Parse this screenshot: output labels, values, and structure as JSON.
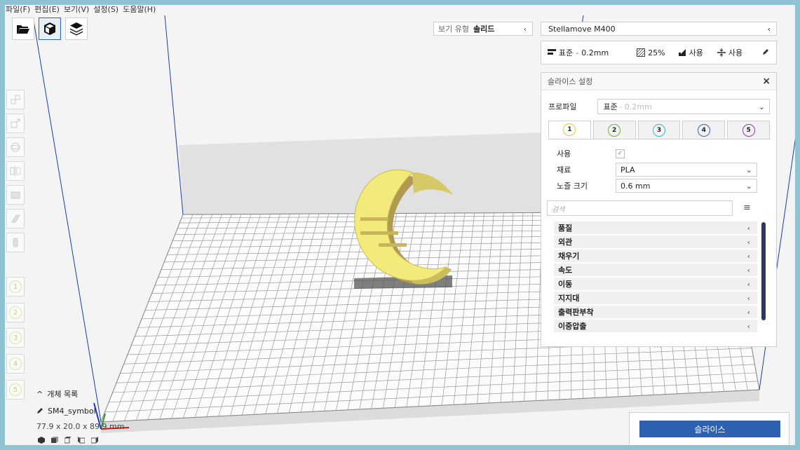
{
  "menu": [
    "파일(F)",
    "편집(E)",
    "보기(V)",
    "설정(S)",
    "도움말(H)"
  ],
  "view_type": {
    "label": "보기 유형",
    "value": "솔리드"
  },
  "printer": {
    "name": "Stellamove M400"
  },
  "quick": {
    "profile_name": "표준",
    "profile_layer": "0.2mm",
    "infill": "25%",
    "support": "사용",
    "adhesion": "사용"
  },
  "panel": {
    "title": "슬라이스 설정",
    "profile_label": "프로파일",
    "profile_name": "표준",
    "profile_layer": "0.2mm",
    "extruder_tabs": [
      "1",
      "2",
      "3",
      "4",
      "5"
    ],
    "fields": {
      "enable_label": "사용",
      "material_label": "재료",
      "material_value": "PLA",
      "nozzle_label": "노즐 크기",
      "nozzle_value": "0.6 mm"
    },
    "search_placeholder": "검색",
    "categories": [
      "품질",
      "외관",
      "채우기",
      "속도",
      "이동",
      "지지대",
      "출력판부착",
      "이중압출"
    ]
  },
  "left_extruders": [
    "1",
    "2",
    "3",
    "4",
    "5"
  ],
  "objects": {
    "header": "개체 목록",
    "name": "SM4_symbol",
    "dimensions": "77.9 x 20.0 x 89.9 mm"
  },
  "slice_button": "슬라이스",
  "colors": {
    "accent": "#2e62b1",
    "model": "#f2ea7a",
    "frame": "#8fc3d4"
  }
}
